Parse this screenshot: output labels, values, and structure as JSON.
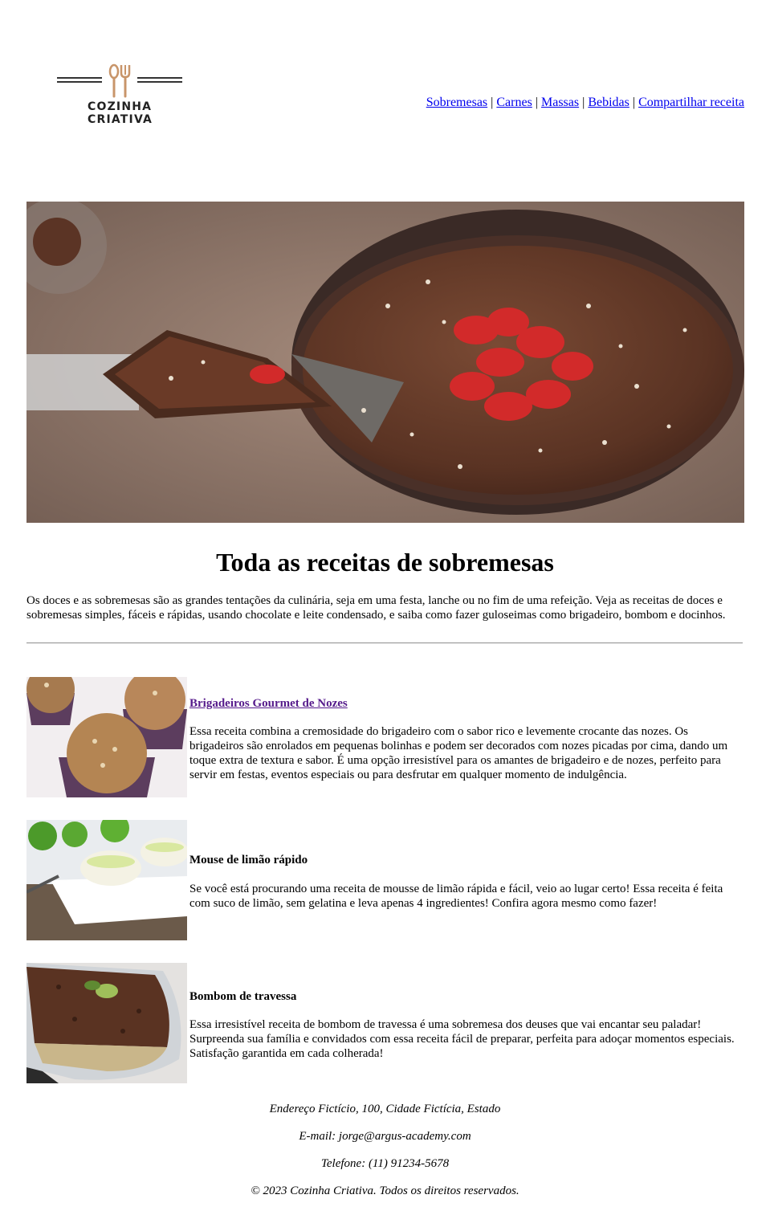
{
  "brand": {
    "line1": "COZINHA",
    "line2": "CRIATIVA"
  },
  "nav": [
    {
      "label": "Sobremesas"
    },
    {
      "label": "Carnes"
    },
    {
      "label": "Massas"
    },
    {
      "label": "Bebidas"
    },
    {
      "label": "Compartilhar receita"
    }
  ],
  "nav_separator": "|",
  "hero": {
    "icon": "chocolate-tart-image"
  },
  "main": {
    "title": "Toda as receitas de sobremesas",
    "intro": "Os doces e as sobremesas são as grandes tentações da culinária, seja em uma festa, lanche ou no fim de uma refeição. Veja as receitas de doces e sobremesas simples, fáceis e rápidas, usando chocolate e leite condensado, e saiba como fazer guloseimas como brigadeiro, bombom e docinhos."
  },
  "recipes": [
    {
      "title": "Brigadeiros Gourmet de Nozes",
      "linked": true,
      "image": "brigadeiro-image",
      "text": "Essa receita combina a cremosidade do brigadeiro com o sabor rico e levemente crocante das nozes. Os brigadeiros são enrolados em pequenas bolinhas e podem ser decorados com nozes picadas por cima, dando um toque extra de textura e sabor. É uma opção irresistível para os amantes de brigadeiro e de nozes, perfeito para servir em festas, eventos especiais ou para desfrutar em qualquer momento de indulgência."
    },
    {
      "title": "Mouse de limão rápido",
      "linked": false,
      "image": "lime-mousse-image",
      "text": "Se você está procurando uma receita de mousse de limão rápida e fácil, veio ao lugar certo! Essa receita é feita com suco de limão, sem gelatina e leva apenas 4 ingredientes! Confira agora mesmo como fazer!"
    },
    {
      "title": "Bombom de travessa",
      "linked": false,
      "image": "bombom-travessa-image",
      "text": "Essa irresistível receita de bombom de travessa é uma sobremesa dos deuses que vai encantar seu paladar! Surpreenda sua família e convidados com essa receita fácil de preparar, perfeita para adoçar momentos especiais. Satisfação garantida em cada colherada!"
    }
  ],
  "footer": {
    "address": "Endereço Fictício, 100, Cidade Fictícia, Estado",
    "email": "E-mail: jorge@argus-academy.com",
    "phone": "Telefone: (11) 91234-5678",
    "copyright": "© 2023 Cozinha Criativa. Todos os direitos reservados."
  },
  "colors": {
    "link": "#0000ee",
    "visited_link": "#551a8b",
    "logo_accent": "#c8956a"
  }
}
